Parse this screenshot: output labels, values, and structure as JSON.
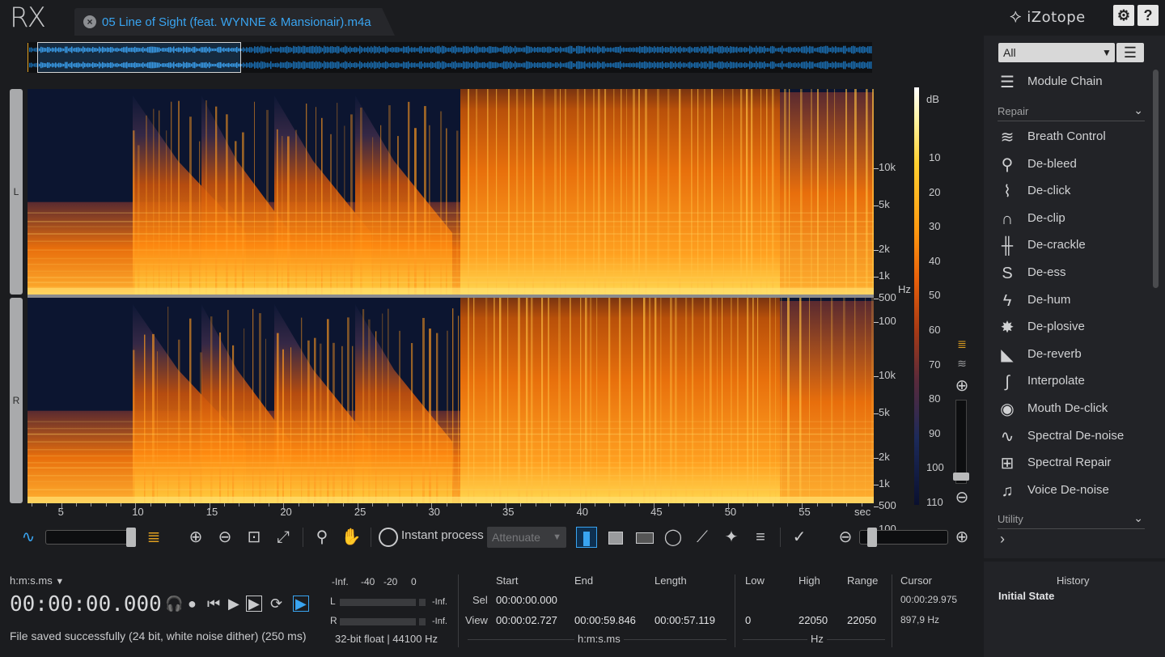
{
  "app": {
    "logo": "RX",
    "brand": "iZotope"
  },
  "tab": {
    "title": "05 Line of Sight (feat. WYNNE & Mansionair).m4a"
  },
  "top_buttons": {
    "settings_icon": "gear-icon",
    "help_label": "?"
  },
  "channels": {
    "left": "L",
    "right": "R"
  },
  "freq_ticks": [
    "10k",
    "5k",
    "2k",
    "1k",
    "500",
    "100"
  ],
  "freq_unit": "Hz",
  "db_scale": {
    "unit": "dB",
    "ticks": [
      "10",
      "20",
      "30",
      "40",
      "50",
      "60",
      "70",
      "80",
      "90",
      "100",
      "110"
    ]
  },
  "time_ticks": [
    "5",
    "10",
    "15",
    "20",
    "25",
    "30",
    "35",
    "40",
    "45",
    "50",
    "55"
  ],
  "time_unit": "sec",
  "toolbar": {
    "instant_process": "Instant process",
    "attenuate": "Attenuate"
  },
  "right_panel": {
    "filter": "All",
    "module_chain": "Module Chain",
    "repair_section": "Repair",
    "utility_section": "Utility",
    "modules": [
      {
        "label": "Breath Control",
        "icon": "breath-icon"
      },
      {
        "label": "De-bleed",
        "icon": "microphone-icon"
      },
      {
        "label": "De-click",
        "icon": "click-icon"
      },
      {
        "label": "De-clip",
        "icon": "clip-icon"
      },
      {
        "label": "De-crackle",
        "icon": "crackle-icon"
      },
      {
        "label": "De-ess",
        "icon": "ess-icon"
      },
      {
        "label": "De-hum",
        "icon": "lightning-icon"
      },
      {
        "label": "De-plosive",
        "icon": "plosive-icon"
      },
      {
        "label": "De-reverb",
        "icon": "reverb-icon"
      },
      {
        "label": "Interpolate",
        "icon": "interpolate-icon"
      },
      {
        "label": "Mouth De-click",
        "icon": "lips-icon"
      },
      {
        "label": "Spectral De-noise",
        "icon": "noise-wave-icon"
      },
      {
        "label": "Spectral Repair",
        "icon": "spectral-repair-icon"
      },
      {
        "label": "Voice De-noise",
        "icon": "voice-icon"
      }
    ]
  },
  "transport": {
    "format": "h:m:s.ms",
    "timecode": "00:00:00.000",
    "status": "File saved successfully (24 bit, white noise dither) (250 ms)"
  },
  "meter": {
    "scale": [
      "-Inf.",
      "-40",
      "-20",
      "0"
    ],
    "l_label": "L",
    "r_label": "R",
    "l_value": "-Inf.",
    "r_value": "-Inf.",
    "format": "32-bit float | 44100 Hz"
  },
  "selection": {
    "headers": [
      "Start",
      "End",
      "Length"
    ],
    "sel_label": "Sel",
    "view_label": "View",
    "sel_start": "00:00:00.000",
    "view_start": "00:00:02.727",
    "view_end": "00:00:59.846",
    "view_length": "00:00:57.119",
    "unit": "h:m:s.ms"
  },
  "frequency": {
    "headers": [
      "Low",
      "High",
      "Range"
    ],
    "low": "0",
    "high": "22050",
    "range": "22050",
    "unit": "Hz"
  },
  "cursor": {
    "label": "Cursor",
    "time": "00:00:29.975",
    "freq": "897,9 Hz"
  },
  "history": {
    "title": "History",
    "items": [
      "Initial State"
    ]
  },
  "colors": {
    "accent": "#39a4f0",
    "spectrogram_hot": "#ff9a10",
    "background": "#1b1c1f"
  }
}
